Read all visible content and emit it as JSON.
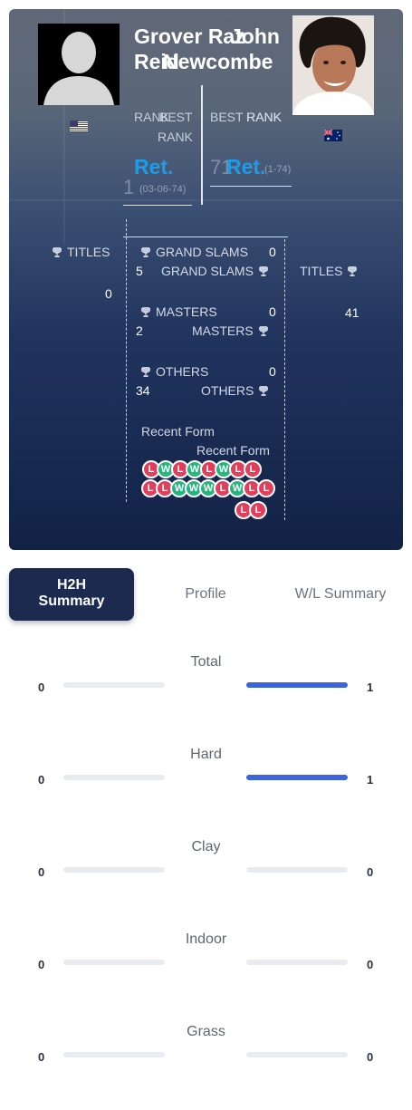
{
  "player_left": {
    "name_line1": "Grover Raz",
    "name_line2": "Reid",
    "country": "US",
    "rank_label_a": "RANK",
    "rank_label_b": "BEST",
    "rank_label_c": "RANK",
    "rank_value": "Ret.",
    "best_rank": "1",
    "best_rank_date": "(03-06-74)",
    "titles_label": "TITLES",
    "titles_value": "0",
    "grand_slams_label": "GRAND SLAMS",
    "grand_slams_value": "0",
    "masters_label": "MASTERS",
    "masters_value": "0",
    "others_label": "OTHERS",
    "others_value": "0",
    "recent_form_label": "Recent Form",
    "recent_form": [
      "L",
      "W",
      "L",
      "W",
      "L",
      "W",
      "L",
      "L"
    ]
  },
  "player_right": {
    "name_line1": "John",
    "name_line2": "Newcombe",
    "country": "AU",
    "rank_label_a": "BEST RANK",
    "rank_label_b": "RANK",
    "rank_value": "Ret.",
    "best_rank": "71",
    "best_rank_date": "(1-74)",
    "titles_label": "TITLES",
    "titles_value": "41",
    "grand_slams_label": "GRAND SLAMS",
    "grand_slams_value": "5",
    "masters_label": "MASTERS",
    "masters_value": "2",
    "others_label": "OTHERS",
    "others_value": "34",
    "recent_form_label": "Recent Form",
    "recent_form": [
      "L",
      "L",
      "W",
      "W",
      "W",
      "L",
      "W",
      "L",
      "L"
    ],
    "recent_form_row2": [
      "L",
      "L"
    ]
  },
  "tabs": [
    {
      "label_line1": "H2H",
      "label_line2": "Summary",
      "active": true
    },
    {
      "label": "Profile",
      "active": false
    },
    {
      "label": "W/L Summary",
      "active": false
    }
  ],
  "summary_rows": [
    {
      "label": "Total",
      "left": "0",
      "right": "1",
      "left_fraction": 0,
      "right_fraction": 1
    },
    {
      "label": "Hard",
      "left": "0",
      "right": "1",
      "left_fraction": 0,
      "right_fraction": 1
    },
    {
      "label": "Clay",
      "left": "0",
      "right": "0",
      "left_fraction": 0,
      "right_fraction": 0
    },
    {
      "label": "Indoor",
      "left": "0",
      "right": "0",
      "left_fraction": 0,
      "right_fraction": 0
    },
    {
      "label": "Grass",
      "left": "0",
      "right": "0",
      "left_fraction": 0,
      "right_fraction": 0
    }
  ],
  "colors": {
    "accent_blue": "#1e9be9",
    "bar_blue": "#3d63dd",
    "loss_red": "#e0405b",
    "win_green": "#28b37f",
    "tab_active_bg": "#1c2a4f"
  },
  "icons": [
    "trophy-icon",
    "us-flag-icon",
    "au-flag-icon",
    "player-silhouette-icon"
  ]
}
